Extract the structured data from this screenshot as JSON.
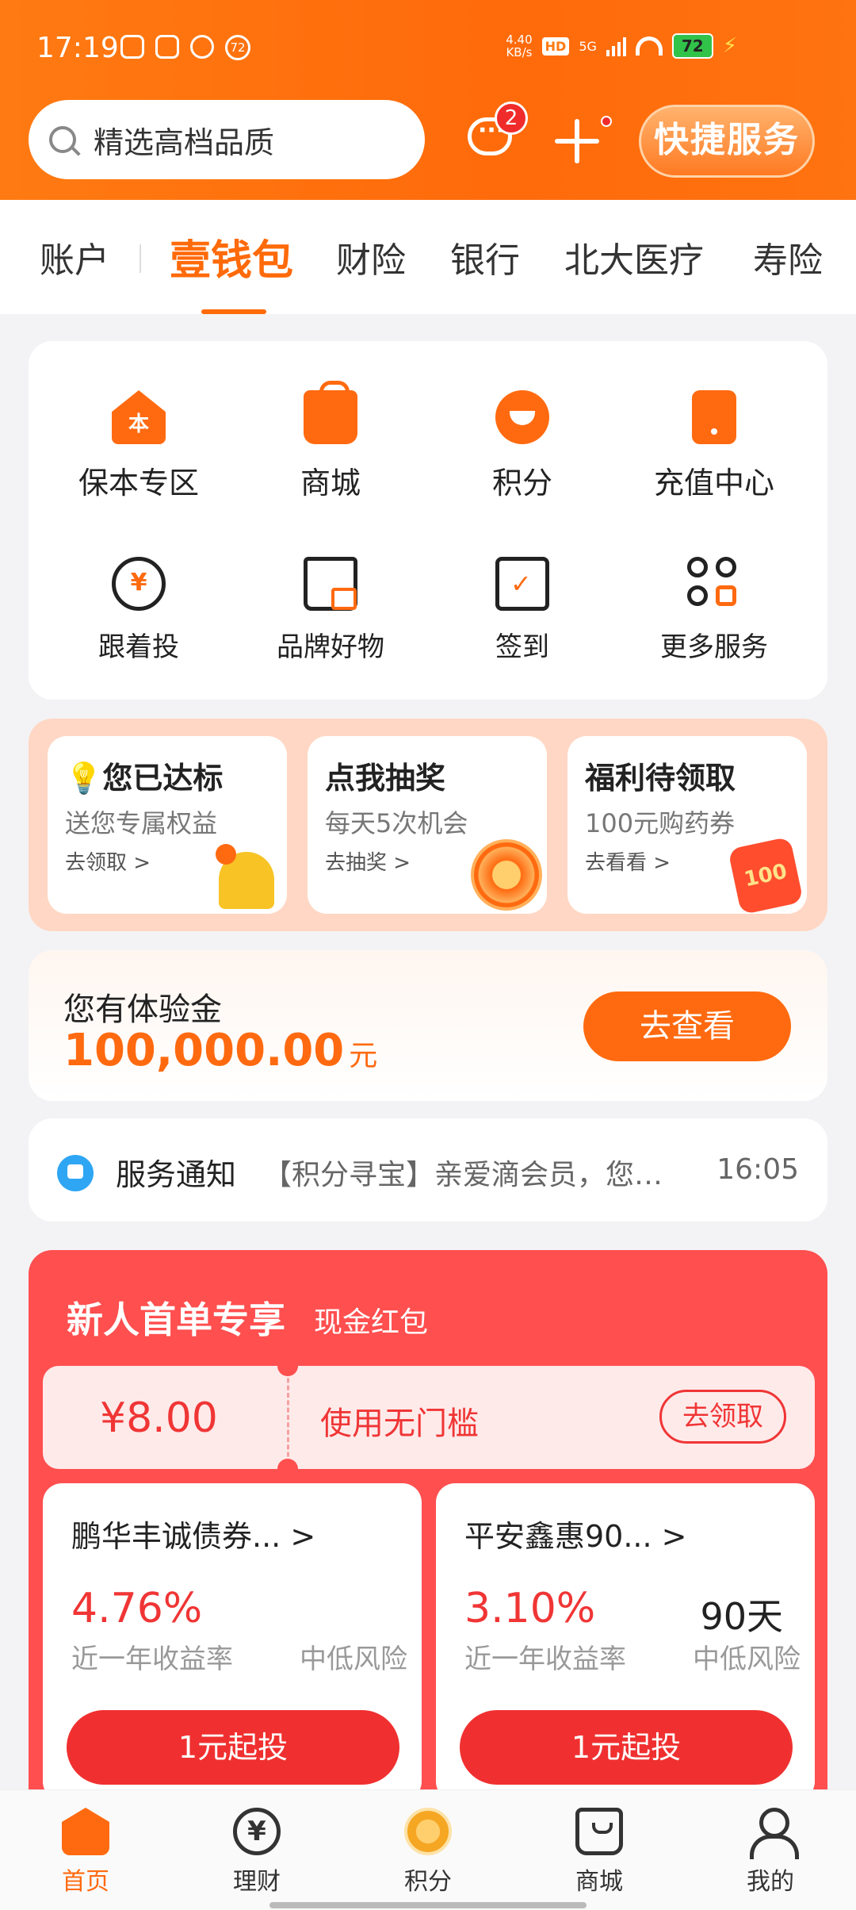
{
  "status_bar": {
    "time": "17:19",
    "notif_count": "72",
    "speed_value": "4.40",
    "speed_unit": "KB/s",
    "hd": "HD",
    "network": "5G",
    "battery": "72"
  },
  "header": {
    "search_placeholder": "精选高档品质",
    "message_badge": "2",
    "quick_service_label": "快捷服务"
  },
  "tabs": [
    {
      "label": "账户"
    },
    {
      "label": "壹钱包",
      "active": true
    },
    {
      "label": "财险"
    },
    {
      "label": "银行"
    },
    {
      "label": "北大医疗"
    },
    {
      "label": "寿险"
    }
  ],
  "services": [
    {
      "label": "保本专区",
      "icon": "principal-house-icon",
      "icon_text": "本"
    },
    {
      "label": "商城",
      "icon": "shopping-bag-icon"
    },
    {
      "label": "积分",
      "icon": "points-coin-icon"
    },
    {
      "label": "充值中心",
      "icon": "phone-recharge-icon"
    },
    {
      "label": "跟着投",
      "icon": "follow-invest-icon",
      "icon_text": "¥"
    },
    {
      "label": "品牌好物",
      "icon": "brand-goods-icon"
    },
    {
      "label": "签到",
      "icon": "calendar-check-icon"
    },
    {
      "label": "更多服务",
      "icon": "more-services-icon"
    }
  ],
  "promos": [
    {
      "title": "您已达标",
      "subtitle": "送您专属权益",
      "link": "去领取 >",
      "icon": "bell-icon"
    },
    {
      "title": "点我抽奖",
      "subtitle": "每天5次机会",
      "link": "去抽奖 >",
      "icon": "lucky-wheel-icon"
    },
    {
      "title": "福利待领取",
      "subtitle": "100元购药券",
      "link": "去看看 >",
      "icon": "red-packet-icon",
      "icon_text": "100"
    }
  ],
  "experience": {
    "label": "您有体验金",
    "amount": "100,000.00",
    "unit": "元",
    "button": "去查看"
  },
  "notice": {
    "title": "服务通知",
    "text": "【积分寻宝】亲爱滴会员，您…",
    "time": "16:05"
  },
  "newcomer": {
    "title": "新人首单专享",
    "subtitle": "现金红包",
    "coupon": {
      "amount": "¥8.00",
      "desc": "使用无门槛",
      "button": "去领取"
    },
    "products": [
      {
        "name": "鹏华丰诚债券... >",
        "rate": "4.76%",
        "rate_label": "近一年收益率",
        "risk": "中低风险",
        "button": "1元起投"
      },
      {
        "name": "平安鑫惠90... >",
        "rate": "3.10%",
        "rate_label": "近一年收益率",
        "days": "90天",
        "risk": "中低风险",
        "button": "1元起投"
      }
    ]
  },
  "bottom_nav": [
    {
      "label": "首页",
      "icon": "home-icon",
      "active": true
    },
    {
      "label": "理财",
      "icon": "wealth-yen-icon",
      "icon_text": "¥"
    },
    {
      "label": "积分",
      "icon": "points-icon"
    },
    {
      "label": "商城",
      "icon": "mall-bag-icon"
    },
    {
      "label": "我的",
      "icon": "profile-icon"
    }
  ],
  "colors": {
    "brand_orange": "#ff6a10",
    "newcomer_red": "#ff4f4f",
    "price_red": "#f03535"
  }
}
